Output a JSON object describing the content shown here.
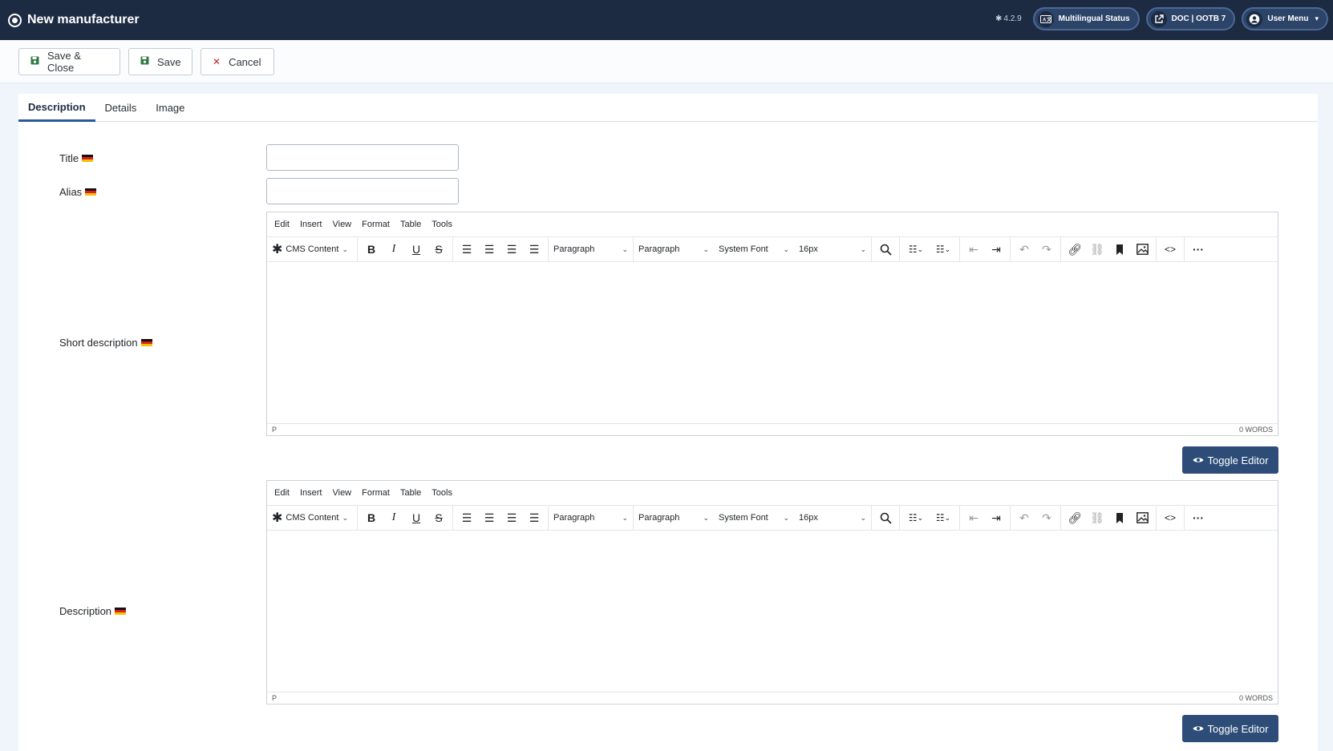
{
  "header": {
    "title": "New manufacturer",
    "version": "4.2.9",
    "multilingual": "Multilingual Status",
    "doc": "DOC | OOTB 7",
    "user_menu": "User Menu"
  },
  "toolbar": {
    "save_close": "Save & Close",
    "save": "Save",
    "cancel": "Cancel"
  },
  "tabs": [
    "Description",
    "Details",
    "Image"
  ],
  "fields": {
    "title_label": "Title",
    "alias_label": "Alias",
    "short_desc_label": "Short description",
    "desc_label": "Description",
    "title_value": "",
    "alias_value": ""
  },
  "editor": {
    "menu": [
      "Edit",
      "Insert",
      "View",
      "Format",
      "Table",
      "Tools"
    ],
    "cms_content": "CMS Content",
    "block_format_1": "Paragraph",
    "block_format_2": "Paragraph",
    "font": "System Font",
    "size": "16px",
    "path": "P",
    "words": "0 WORDS",
    "toggle": "Toggle Editor"
  },
  "colors": {
    "header_bg": "#1c2a42",
    "accent": "#2d4d78",
    "save_icon": "#2f7a43",
    "cancel_icon": "#c52827"
  }
}
